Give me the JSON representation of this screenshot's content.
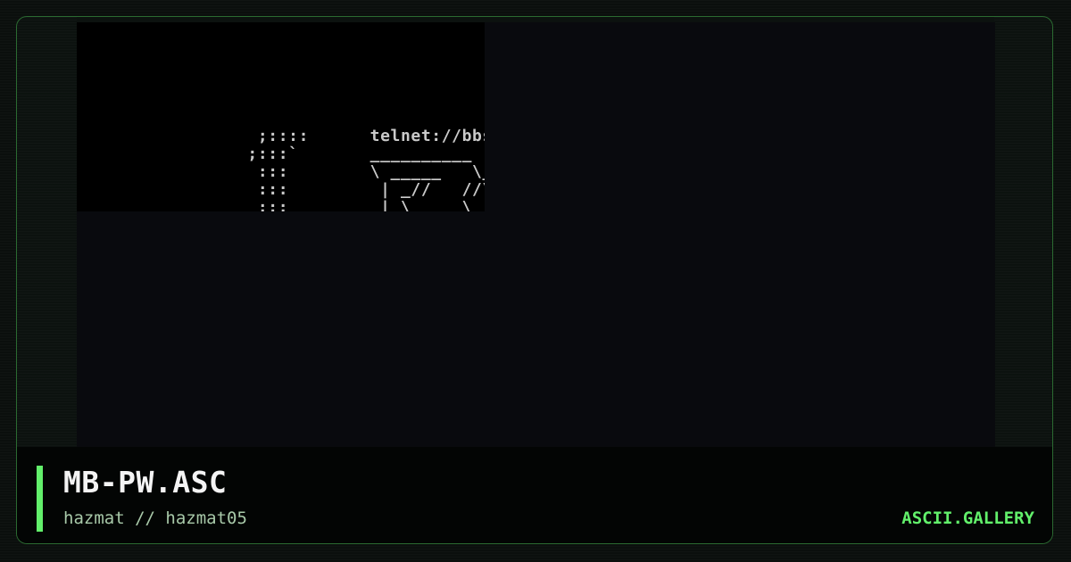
{
  "artwork": {
    "lines": [
      "  ;::::      telnet://bbs.",
      " ;:::`       __________",
      "  :::        \\ _____   \\__",
      "  :::         | _//   //\\",
      "  :::         | \\     \\"
    ]
  },
  "caption": {
    "title": "MB-PW.ASC",
    "author_line": "hazmat // hazmat05",
    "brand": "ASCII.GALLERY"
  },
  "colors": {
    "accent": "#62f06b",
    "frame_border": "#2b6a31",
    "art_text": "#c9c9c9",
    "title_text": "#f4f4f4"
  }
}
